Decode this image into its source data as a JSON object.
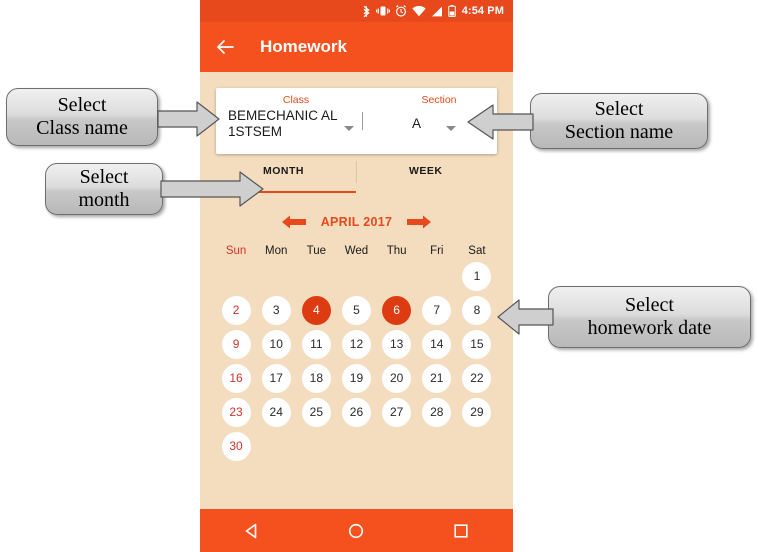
{
  "statusbar": {
    "time": "4:54 PM",
    "icons": [
      "bluetooth-icon",
      "vibrate-icon",
      "alarm-icon",
      "wifi-icon",
      "signal-icon",
      "battery-icon"
    ]
  },
  "appbar": {
    "back_icon": "back-arrow-icon",
    "title": "Homework"
  },
  "form": {
    "class_label": "Class",
    "class_value": "BEMECHANIC AL1STSEM",
    "section_label": "Section",
    "section_value": "A"
  },
  "tabs": {
    "month": "MONTH",
    "week": "WEEK",
    "active": "MONTH"
  },
  "month_nav": {
    "prev_icon": "arrow-left-icon",
    "label": "APRIL 2017",
    "next_icon": "arrow-right-icon"
  },
  "calendar": {
    "dow": [
      "Sun",
      "Mon",
      "Tue",
      "Wed",
      "Thu",
      "Fri",
      "Sat"
    ],
    "weeks": [
      [
        "",
        "",
        "",
        "",
        "",
        "",
        "1"
      ],
      [
        "2",
        "3",
        "4",
        "5",
        "6",
        "7",
        "8"
      ],
      [
        "9",
        "10",
        "11",
        "12",
        "13",
        "14",
        "15"
      ],
      [
        "16",
        "17",
        "18",
        "19",
        "20",
        "21",
        "22"
      ],
      [
        "23",
        "24",
        "25",
        "26",
        "27",
        "28",
        "29"
      ],
      [
        "30",
        "",
        "",
        "",
        "",
        "",
        ""
      ]
    ],
    "selected": [
      "4",
      "6"
    ]
  },
  "navbar": {
    "back": "back-triangle-icon",
    "home": "home-circle-icon",
    "recents": "recents-square-icon"
  },
  "callouts": [
    {
      "id": "class-name",
      "line1": "Select",
      "line2": "Class name"
    },
    {
      "id": "section-name",
      "line1": "Select",
      "line2": "Section name"
    },
    {
      "id": "month",
      "line1": "Select",
      "line2": "month"
    },
    {
      "id": "homework-date",
      "line1": "Select",
      "line2": "homework date"
    }
  ],
  "colors": {
    "primary": "#f4511e",
    "status_bar": "#e8491c",
    "accent": "#e8491c",
    "selected_day": "#dd3c13",
    "screen_bg": "#f4dcbe",
    "sunday_text": "#d0342c"
  }
}
